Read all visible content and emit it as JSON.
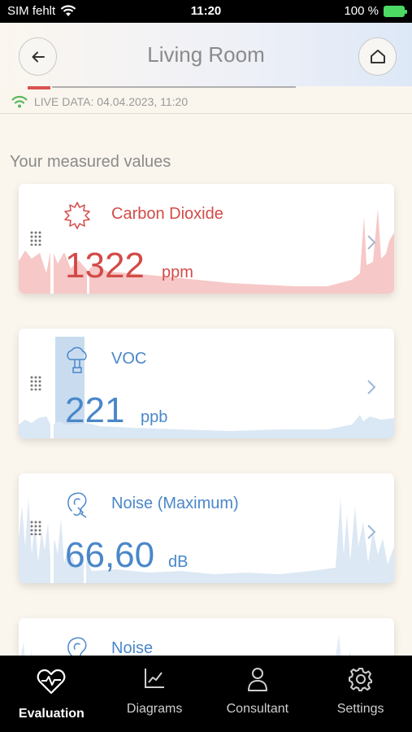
{
  "status_bar": {
    "carrier": "SIM fehlt",
    "time": "11:20",
    "battery": "100 %"
  },
  "header": {
    "title": "Living Room"
  },
  "live": {
    "text": "LIVE DATA: 04.04.2023, 11:20"
  },
  "section_title": "Your measured values",
  "cards": [
    {
      "name": "Carbon Dioxide",
      "value": "1322",
      "unit": "ppm",
      "color": "#d24b48"
    },
    {
      "name": "VOC",
      "value": "221",
      "unit": "ppb",
      "color": "#4a87c9"
    },
    {
      "name": "Noise (Maximum)",
      "value": "66,60",
      "unit": "dB",
      "color": "#4a87c9"
    },
    {
      "name": "Noise",
      "color": "#4a87c9"
    }
  ],
  "tabs": [
    {
      "label": "Evaluation",
      "icon": "heart-pulse-icon",
      "active": true
    },
    {
      "label": "Diagrams",
      "icon": "line-chart-icon"
    },
    {
      "label": "Consultant",
      "icon": "person-icon"
    },
    {
      "label": "Settings",
      "icon": "gear-icon"
    }
  ]
}
